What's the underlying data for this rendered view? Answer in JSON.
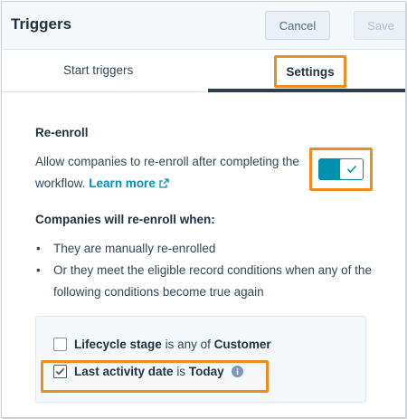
{
  "header": {
    "title": "Triggers",
    "cancel_label": "Cancel",
    "save_label": "Save"
  },
  "tabs": [
    {
      "label": "Start triggers",
      "active": false
    },
    {
      "label": "Settings",
      "active": true
    }
  ],
  "reenroll": {
    "heading": "Re-enroll",
    "description": "Allow companies to re-enroll after completing the workflow.",
    "learn_more": "Learn more",
    "toggle_on": true
  },
  "conditions": {
    "heading": "Companies will re-enroll when:",
    "bullets": [
      "They are manually re-enrolled",
      "Or they meet the eligible record conditions when any of the following conditions become true again"
    ],
    "items": [
      {
        "property": "Lifecycle stage",
        "operator": "is any of",
        "value": "Customer",
        "checked": false
      },
      {
        "property": "Last activity date",
        "operator": "is",
        "value": "Today",
        "checked": true
      }
    ]
  },
  "colors": {
    "accent": "#0091ae",
    "highlight": "#f08c1f",
    "header_bg": "#f5f8fa"
  }
}
